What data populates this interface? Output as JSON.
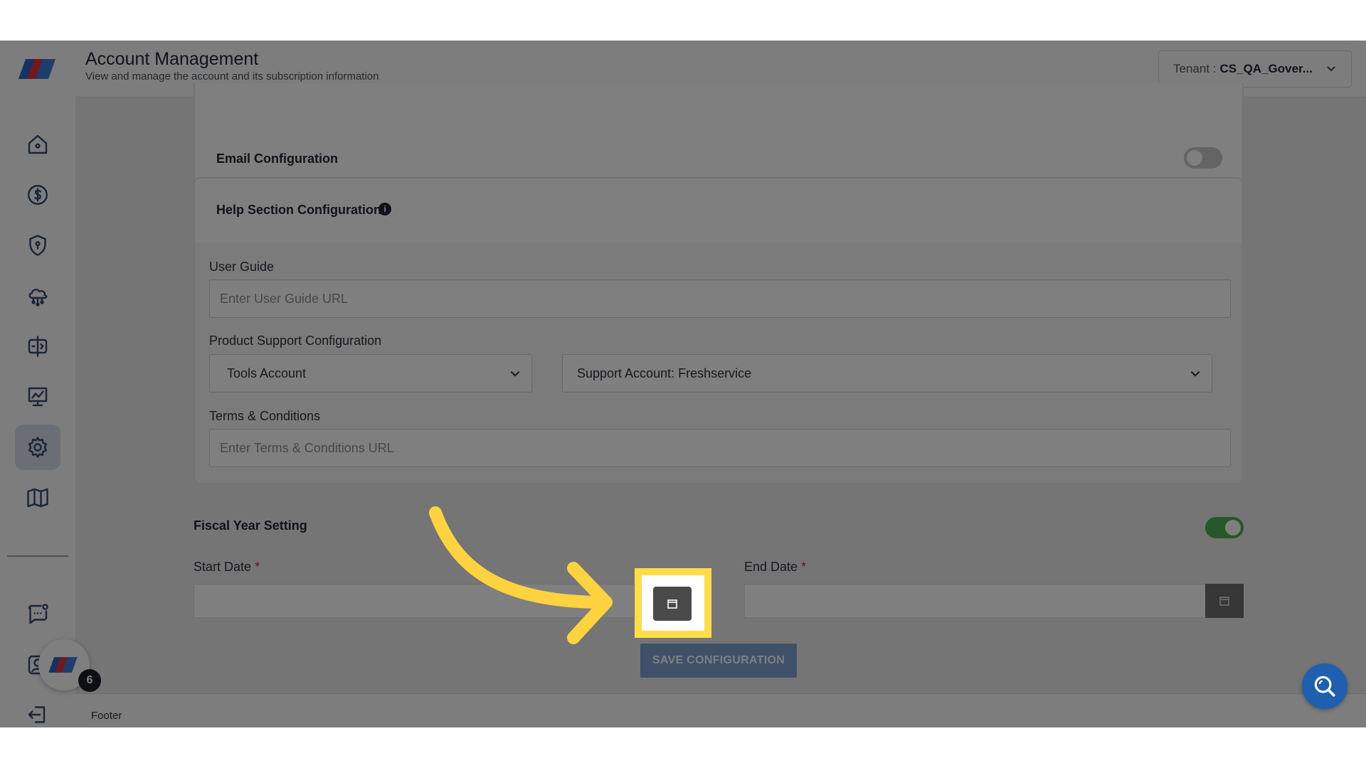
{
  "header": {
    "title": "Account Management",
    "subtitle": "View and manage the account and its subscription information",
    "tenant_label": "Tenant :",
    "tenant_value": "CS_QA_Gover..."
  },
  "sidebar": {
    "items": [
      {
        "name": "home",
        "icon": "home-icon"
      },
      {
        "name": "billing",
        "icon": "dollar-icon"
      },
      {
        "name": "security",
        "icon": "shield-icon"
      },
      {
        "name": "cloud",
        "icon": "cloud-network-icon"
      },
      {
        "name": "compare",
        "icon": "split-icon"
      },
      {
        "name": "monitor",
        "icon": "presentation-chart-icon"
      },
      {
        "name": "settings",
        "icon": "gear-icon",
        "active": true
      },
      {
        "name": "docs",
        "icon": "book-icon"
      },
      {
        "name": "chat",
        "icon": "chat-icon"
      },
      {
        "name": "profile",
        "icon": "user-icon"
      },
      {
        "name": "logout",
        "icon": "logout-icon"
      }
    ],
    "notification_count": "6"
  },
  "email": {
    "label": "Email Configuration",
    "enabled": false
  },
  "help": {
    "title": "Help Section Configuration",
    "info_glyph": "i",
    "user_guide_label": "User Guide",
    "user_guide_placeholder": "Enter User Guide URL",
    "product_support_label": "Product Support Configuration",
    "tools_account": "Tools Account",
    "support_account": "Support Account: Freshservice",
    "terms_label": "Terms & Conditions",
    "terms_placeholder": "Enter Terms & Conditions URL"
  },
  "fiscal": {
    "title": "Fiscal Year Setting",
    "enabled": true,
    "start_label": "Start Date",
    "end_label": "End Date",
    "required_mark": "*"
  },
  "save_label": "SAVE CONFIGURATION",
  "footer": {
    "text": "Footer"
  },
  "colors": {
    "accent": "#1e5fb0",
    "highlight": "#ffdc4a",
    "toggle_on": "#4caf50"
  }
}
